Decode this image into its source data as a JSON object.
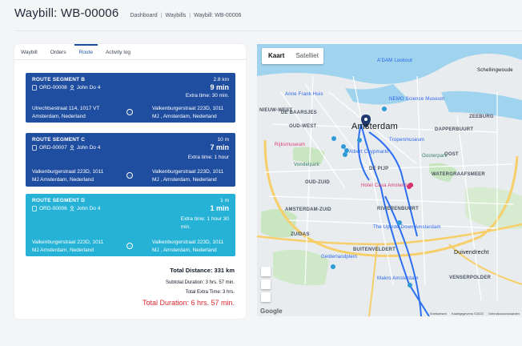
{
  "header": {
    "title": "Waybill: WB-00006",
    "breadcrumb": [
      "Dashboard",
      "Waybills",
      "Waybill: WB-00006"
    ],
    "breadcrumb_sep": "|"
  },
  "tabs": [
    {
      "label": "Waybill",
      "active": false
    },
    {
      "label": "Orders",
      "active": false
    },
    {
      "label": "Route",
      "active": true
    },
    {
      "label": "Activity log",
      "active": false
    }
  ],
  "segments": [
    {
      "title": "ROUTE SEGMENT B",
      "order": "ORD-00008",
      "driver": "John Do 4",
      "distance": "2.8 km",
      "duration": "9 min",
      "extra": "Extra time: 30 min.",
      "from_line1": "Utrechtsestraat 114, 1017 VT",
      "from_line2": "Amsterdam, Nederland",
      "to_line1": "Valkenburgerstraat 223D, 1011",
      "to_line2": "MJ , Amsterdam, Nederland"
    },
    {
      "title": "ROUTE SEGMENT C",
      "order": "ORD-00007",
      "driver": "John Do 4",
      "distance": "10 m",
      "duration": "7 min",
      "extra": "Extra time: 1 hour",
      "from_line1": "Valkenburgerstraat 223D, 1011",
      "from_line2": "MJ Amsterdam, Nederland",
      "to_line1": "Valkenburgerstraat 223D, 1011",
      "to_line2": "MJ , Amsterdam, Nederland"
    },
    {
      "title": "ROUTE SEGMENT D",
      "order": "ORD-00006",
      "driver": "John Do 4",
      "distance": "1 m",
      "duration": "1 min",
      "extra_line1": "Extra time: 1 hour 30",
      "extra_line2": "min.",
      "from_line1": "Valkenburgerstraat 223D, 1011",
      "from_line2": "MJ Amsterdam, Nederland",
      "to_line1": "Valkenburgerstraat 223D, 1011",
      "to_line2": "MJ , Amsterdam, Nederland"
    }
  ],
  "totals": {
    "distance": "Total Distance: 331 km",
    "subtotal": "Subtotal Duration: 3 hrs. 57 min.",
    "extra": "Total Extra Time: 3 hrs.",
    "total": "Total Duration: 6 hrs. 57 min."
  },
  "map": {
    "toggle": [
      "Kaart",
      "Satelliet"
    ],
    "labels": {
      "amsterdam": "Amsterdam",
      "rijksmuseum": "Rijksmuseum",
      "anne_frank": "Anne Frank Huis",
      "nemo": "NEMO Science Museum",
      "adam": "A'DAM Lookout",
      "albert": "Albert Cuypmarkt",
      "tropen": "Tropenmuseum",
      "hotel": "Hotel Casa Amsterdam",
      "upside": "The Upside Down Amsterdam",
      "gelderland": "Gelderlandplein",
      "makro": "Makro Amsterdam",
      "depijp": "DE PIJP",
      "zuid": "AMSTERDAM-ZUID",
      "zuidas": "ZUIDAS",
      "buitenveldert": "BUITENVELDERT",
      "duivendrecht": "Duivendrecht",
      "venserpolder": "VENSERPOLDER",
      "oost": "OOST",
      "vondelpark": "Vondelpark",
      "oostpark": "Oosterpark",
      "dapper": "DAPPERBUURT",
      "zeeburg": "ZEEBURG",
      "watergraafsmeer": "WATERGRAAFSMEER",
      "schellingwoude": "Schellingwoude",
      "oudzuid": "OUD-ZUID",
      "rivierenbuurt": "RIVIERENBUURT",
      "nieuw_west": "NIEUW-WEST",
      "de_baarsjes": "DE BAARSJES",
      "oud_west": "OUD-WEST",
      "google": "Google"
    },
    "footer": [
      "Sneltoetsen",
      "Kaartgegevens ©2023",
      "Gebruiksvoorwaarden"
    ]
  },
  "colors": {
    "segment_dark": "#1f4ea0",
    "segment_light": "#26b2d6",
    "total_red": "#d9272e",
    "route_line": "#2c6ff0"
  }
}
